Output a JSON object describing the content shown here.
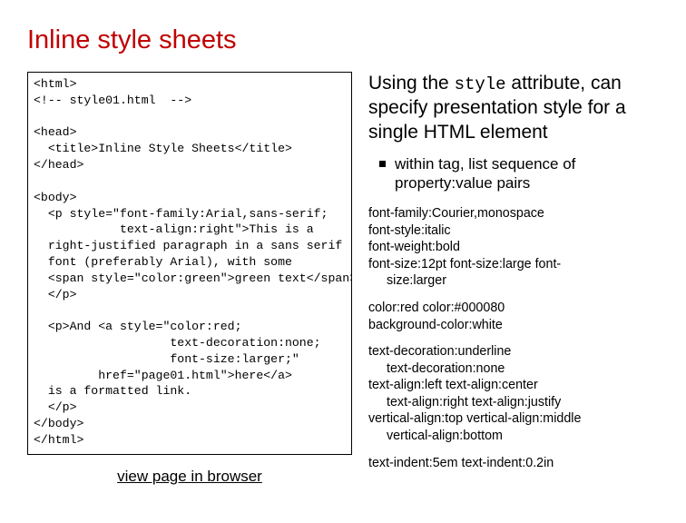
{
  "title": "Inline style sheets",
  "code": "<html>\n<!-- style01.html  -->\n\n<head>\n  <title>Inline Style Sheets</title>\n</head>\n\n<body>\n  <p style=\"font-family:Arial,sans-serif;\n            text-align:right\">This is a\n  right-justified paragraph in a sans serif\n  font (preferably Arial), with some\n  <span style=\"color:green\">green text</span>.\n  </p>\n\n  <p>And <a style=\"color:red;\n                   text-decoration:none;\n                   font-size:larger;\"\n         href=\"page01.html\">here</a>\n  is a formatted link.\n  </p>\n</body>\n</html>",
  "view_link": "view page in browser",
  "right_main_1": "Using the ",
  "right_main_code": "style",
  "right_main_2": " attribute, can specify presentation style for a single HTML element",
  "bullet_text": "within tag, list sequence of property:value pairs",
  "grp1_l1": "font-family:Courier,monospace",
  "grp1_l2": "font-style:italic",
  "grp1_l3": "font-weight:bold",
  "grp1_l4": "font-size:12pt   font-size:large   font-",
  "grp1_l5": "size:larger",
  "grp2_l1": "color:red   color:#000080",
  "grp2_l2": "background-color:white",
  "grp3_l1": "text-decoration:underline",
  "grp3_l2": "text-decoration:none",
  "grp3_l3": "text-align:left   text-align:center",
  "grp3_l4": "text-align:right   text-align:justify",
  "grp3_l5": "vertical-align:top   vertical-align:middle",
  "grp3_l6": "vertical-align:bottom",
  "grp4_l1": "text-indent:5em   text-indent:0.2in"
}
